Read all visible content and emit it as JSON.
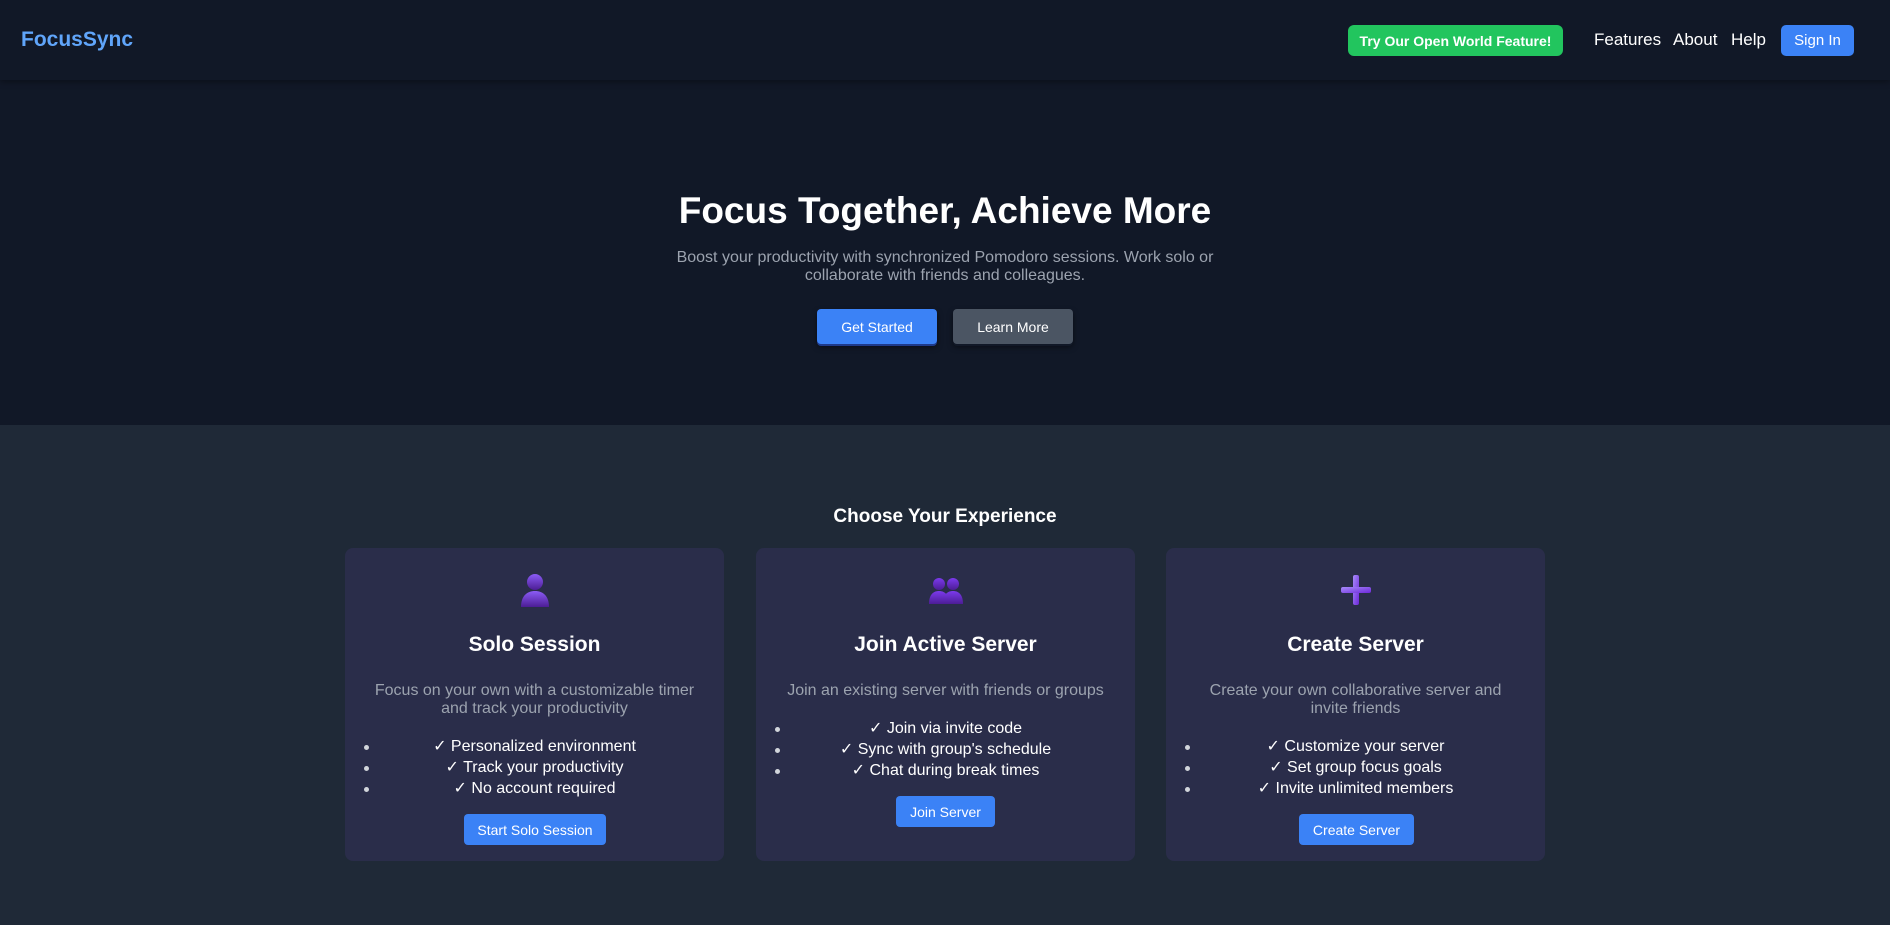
{
  "navbar": {
    "brand": "FocusSync",
    "open_world_label": "Try Our Open World Feature!",
    "links": [
      "Features",
      "About",
      "Help"
    ],
    "sign_in_label": "Sign In"
  },
  "hero": {
    "title": "Focus Together, Achieve More",
    "subtitle": "Boost your productivity with synchronized Pomodoro sessions. Work solo or collaborate with friends and colleagues.",
    "get_started_label": "Get Started",
    "learn_more_label": "Learn More"
  },
  "experience": {
    "title": "Choose Your Experience",
    "cards": [
      {
        "icon": "person-icon",
        "title": "Solo Session",
        "description": "Focus on your own with a customizable timer and track your productivity",
        "features": [
          "✓ Personalized environment",
          "✓ Track your productivity",
          "✓ No account required"
        ],
        "button": "Start Solo Session"
      },
      {
        "icon": "group-icon",
        "title": "Join Active Server",
        "description": "Join an existing server with friends or groups",
        "features": [
          "✓ Join via invite code",
          "✓ Sync with group's schedule",
          "✓ Chat during break times"
        ],
        "button": "Join Server"
      },
      {
        "icon": "plus-icon",
        "title": "Create Server",
        "description": "Create your own collaborative server and invite friends",
        "features": [
          "✓ Customize your server",
          "✓ Set group focus goals",
          "✓ Invite unlimited members"
        ],
        "button": "Create Server"
      }
    ]
  },
  "colors": {
    "brand": "#60a5fa",
    "primary_button": "#3b82f6",
    "open_world_button": "#22c55e",
    "secondary_button": "#4b5563",
    "hero_background": "#111827",
    "page_background": "#1f2937",
    "card_background": "#2a2d4a",
    "icon_purple": "#7c3aed"
  }
}
